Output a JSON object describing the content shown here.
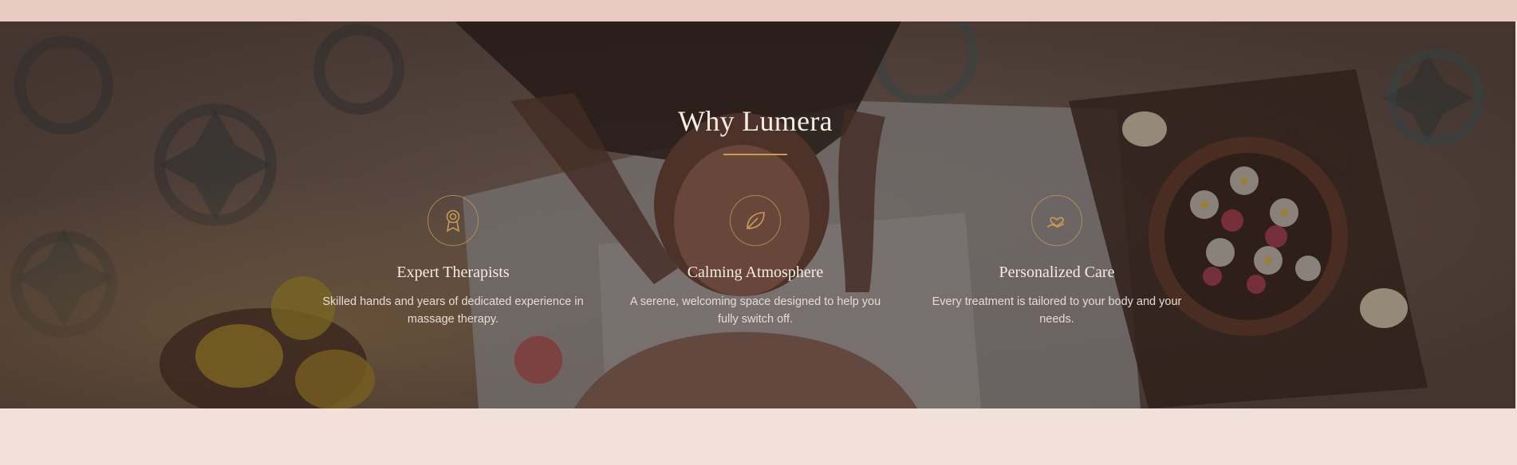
{
  "section": {
    "title": "Why Lumera"
  },
  "features": [
    {
      "icon": "award-ribbon-icon",
      "title": "Expert Therapists",
      "text": "Skilled hands and years of dedicated experience in massage therapy."
    },
    {
      "icon": "leaf-icon",
      "title": "Calming Atmosphere",
      "text": "A serene, welcoming space designed to help you fully switch off."
    },
    {
      "icon": "heart-hand-icon",
      "title": "Personalized Care",
      "text": "Every treatment is tailored to your body and your needs."
    }
  ],
  "colors": {
    "accent": "#c99a58",
    "page_background": "#f2e1da",
    "top_strip": "#e7cbc3"
  }
}
